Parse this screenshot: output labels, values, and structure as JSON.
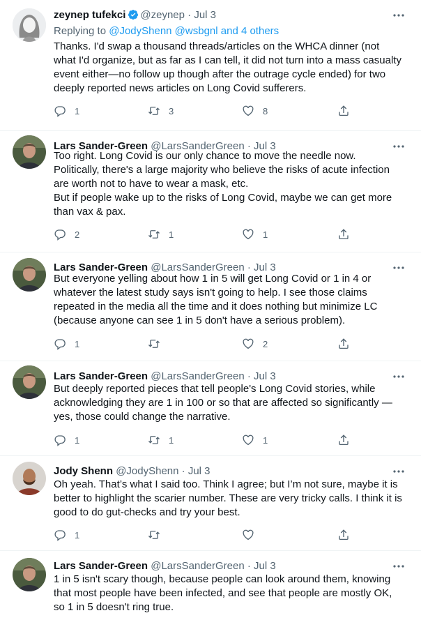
{
  "tweets": [
    {
      "name": "zeynep tufekci",
      "verified": true,
      "handle": "@zeynep",
      "date": "Jul 3",
      "reply_prefix": "Replying to",
      "reply_to": "@JodyShenn @wsbgnl and 4 others",
      "text": "Thanks. I'd swap a thousand threads/articles on the WHCA dinner (not\nwhat I'd organize, but as far as I can tell, it did not turn into a mass casualty\nevent either—no follow up though after the outrage cycle ended) for two\ndeeply reported news articles on Long Covid sufferers.",
      "replies": "1",
      "retweets": "3",
      "likes": "8"
    },
    {
      "name": "Lars Sander-Green",
      "handle": "@LarsSanderGreen",
      "date": "Jul 3",
      "text": "Too right. Long Covid is our only chance to move the needle now.\nPolitically, there's a large majority who believe the risks of acute infection\nare worth not to have to wear a mask, etc.\nBut if people wake up to the risks of Long Covid, maybe we can get more\nthan vax & pax.",
      "replies": "2",
      "retweets": "1",
      "likes": "1"
    },
    {
      "name": "Lars Sander-Green",
      "handle": "@LarsSanderGreen",
      "date": "Jul 3",
      "text": "But everyone yelling about how 1 in 5 will get Long Covid or 1 in 4 or\nwhatever the latest study says isn't going to help. I see those claims\nrepeated in the media all the time and it does nothing but minimize LC\n(because anyone can see 1 in 5 don't have a serious problem).",
      "replies": "1",
      "retweets": "",
      "likes": "2"
    },
    {
      "name": "Lars Sander-Green",
      "handle": "@LarsSanderGreen",
      "date": "Jul 3",
      "text": "But deeply reported pieces that tell people's Long Covid stories, while\nacknowledging they are 1 in 100 or so that are affected so significantly —\nyes, those could change the narrative.",
      "replies": "1",
      "retweets": "1",
      "likes": "1"
    },
    {
      "name": "Jody Shenn",
      "handle": "@JodyShenn",
      "date": "Jul 3",
      "text": "Oh yeah. That’s what I said too. Think I agree; but I’m not sure, maybe it is\nbetter to highlight the scarier number. These are very tricky calls. I think it is\ngood to do gut-checks and try your best.",
      "replies": "1",
      "retweets": "",
      "likes": ""
    },
    {
      "name": "Lars Sander-Green",
      "handle": "@LarsSanderGreen",
      "date": "Jul 3",
      "text": "1 in 5 isn't scary though, because people can look around them, knowing\nthat most people have been infected, and see that people are mostly OK,\nso 1 in 5 doesn't ring true."
    }
  ],
  "dot": "·",
  "icons": [
    "reply-icon",
    "retweet-icon",
    "like-icon",
    "share-icon",
    "more-icon",
    "verified-icon"
  ],
  "colors": {
    "text": "#0f1419",
    "muted": "#536471",
    "link": "#1d9bf0",
    "divider": "#eff3f4"
  }
}
